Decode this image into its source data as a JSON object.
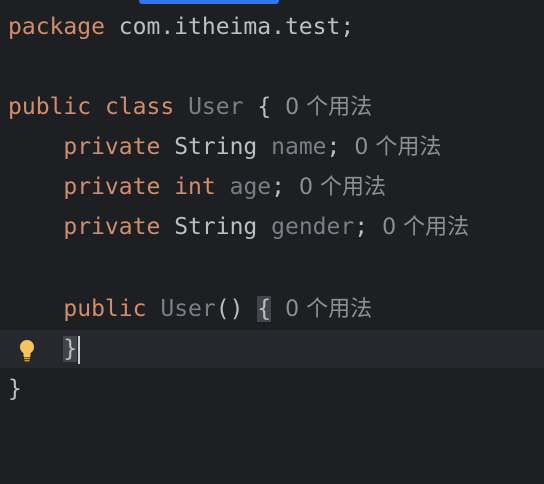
{
  "editor": {
    "line1": {
      "kw": "package",
      "rest": " com.itheima.test;"
    },
    "line3": {
      "kw1": "public",
      "kw2": "class",
      "name": "User",
      "brace": "{",
      "hint": "0 个用法"
    },
    "line4": {
      "kw": "private",
      "type": "String",
      "field": "name",
      "semi": ";",
      "hint": "0 个用法"
    },
    "line5": {
      "kw": "private",
      "type": "int",
      "field": "age",
      "semi": ";",
      "hint": "0 个用法"
    },
    "line6": {
      "kw": "private",
      "type": "String",
      "field": "gender",
      "semi": ";",
      "hint": "0 个用法"
    },
    "line8": {
      "kw": "public",
      "name": "User",
      "parens": "()",
      "brace": "{",
      "hint": "0 个用法"
    },
    "line9": {
      "brace": "}"
    },
    "line10": {
      "brace": "}"
    }
  },
  "colors": {
    "background": "#1e1f22",
    "keyword": "#cf8e6d",
    "identifier": "#bcbec4",
    "unused": "#7a7e85",
    "inlay_hint": "#8c8f94",
    "accent": "#3574f0"
  },
  "icons": {
    "gutter_intention": "lightbulb-icon"
  }
}
